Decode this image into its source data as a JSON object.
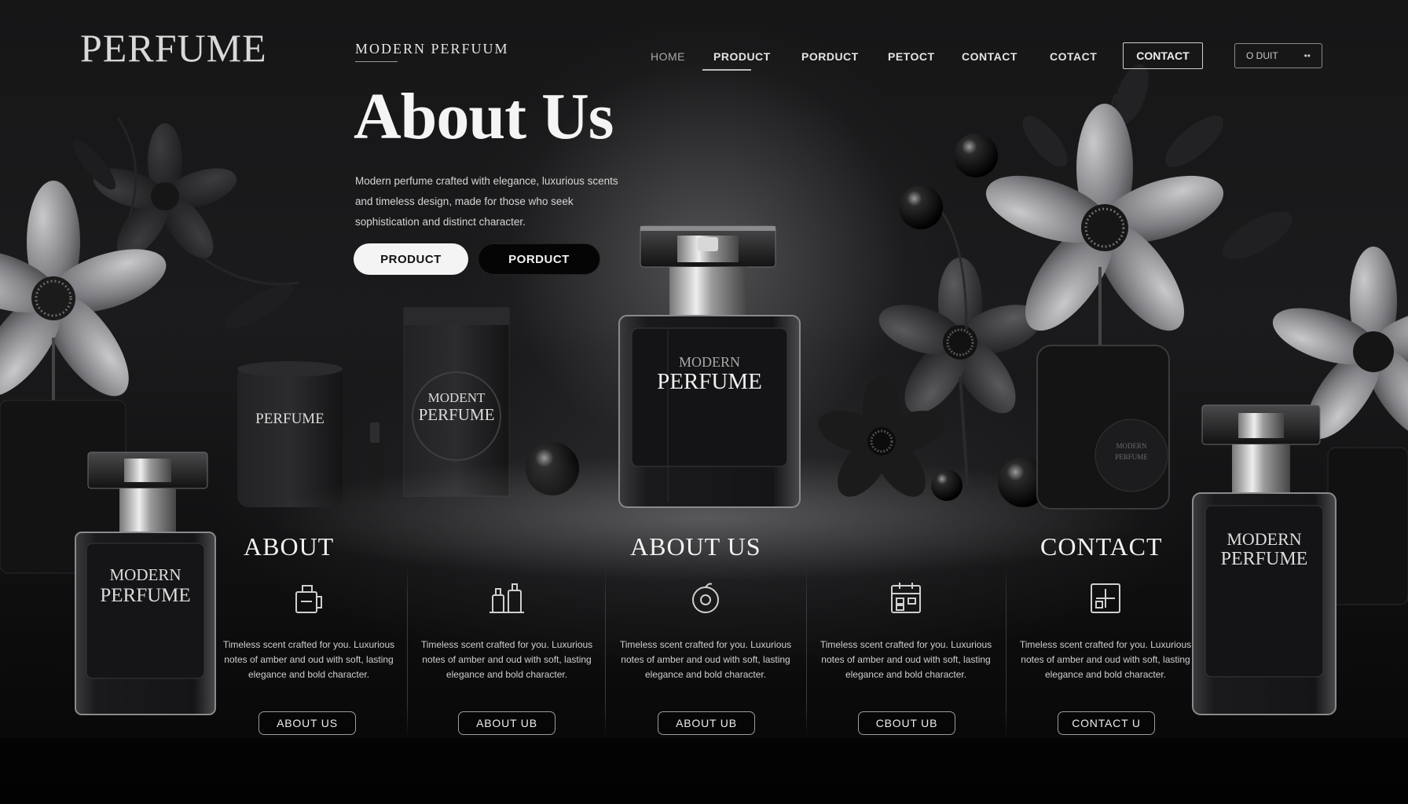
{
  "header": {
    "logo": "PERFUME",
    "tagline": "MODERN PERFUUM",
    "nav": [
      {
        "label": "HOME"
      },
      {
        "label": "PRODUCT"
      },
      {
        "label": "PORDUCT"
      },
      {
        "label": "PETOCT"
      },
      {
        "label": "CONTACT"
      },
      {
        "label": "COTACT"
      }
    ],
    "nav_button": "CONTACT",
    "nav_pill_left": "O DUIT",
    "nav_pill_right": "••"
  },
  "hero": {
    "title": "About Us",
    "text": "Modern perfume crafted with elegance, luxurious scents and timeless design, made for those who seek sophistication and distinct character.",
    "button_primary": "PRODUCT",
    "button_secondary": "PORDUCT"
  },
  "bottles": {
    "left_box_label": "PERFUME",
    "left_pack_label_line1": "MODENT",
    "left_pack_label_line2": "PERFUME",
    "center_label_line1": "MODERN",
    "center_label_line2": "PERFUME",
    "front_left_line1": "MODERN",
    "front_left_line2": "PERFUME",
    "right_label_line1": "MODERN",
    "right_label_line2": "PERFUME",
    "right_glass_label_line1": "MODERN",
    "right_glass_label_line2": "PERFUME"
  },
  "sections": {
    "title_about": "ABOUT",
    "title_about_us": "ABOUT US",
    "title_contact": "CONTACT",
    "columns": [
      {
        "icon": "bottle-sketch-icon",
        "text": "Timeless scent crafted for you. Luxurious notes of amber and oud with soft, lasting elegance and bold character.",
        "button": "ABOUT US"
      },
      {
        "icon": "perfume-set-icon",
        "text": "Timeless scent crafted for you. Luxurious notes of amber and oud with soft, lasting elegance and bold character.",
        "button": "ABOUT UB"
      },
      {
        "icon": "apple-icon",
        "text": "Timeless scent crafted for you. Luxurious notes of amber and oud with soft, lasting elegance and bold character.",
        "button": "ABOUT UB"
      },
      {
        "icon": "calendar-grid-icon",
        "text": "Timeless scent crafted for you. Luxurious notes of amber and oud with soft, lasting elegance and bold character.",
        "button": "CBOUT UB"
      },
      {
        "icon": "grid-plus-icon",
        "text": "Timeless scent crafted for you. Luxurious notes of amber and oud with soft, lasting elegance and bold character.",
        "button": "CONTACT U"
      }
    ]
  },
  "colors": {
    "background": "#0b0b0c",
    "text": "#eaeaea",
    "accent": "#f4f4f4"
  }
}
